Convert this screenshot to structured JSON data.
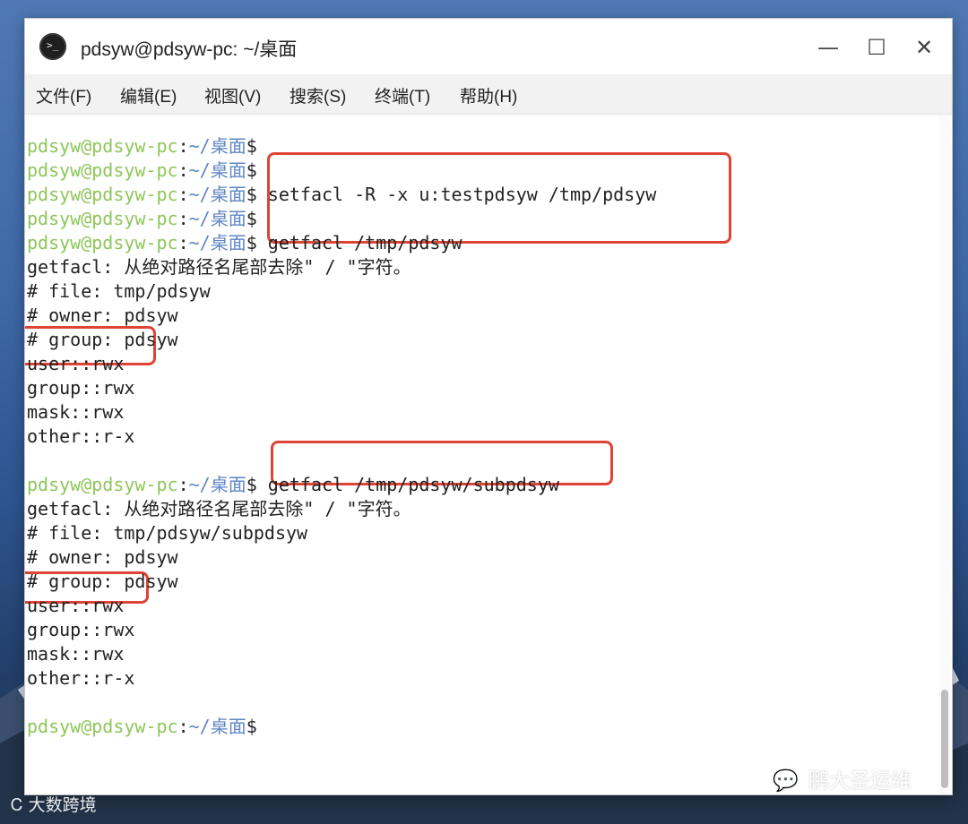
{
  "window": {
    "title": "pdsyw@pdsyw-pc: ~/桌面",
    "app_icon_glyph": ">_",
    "controls": {
      "minimize": "—",
      "maximize": "☐",
      "close": "✕"
    }
  },
  "menu": [
    "文件(F)",
    "编辑(E)",
    "视图(V)",
    "搜索(S)",
    "终端(T)",
    "帮助(H)"
  ],
  "prompt": {
    "user_host": "pdsyw@pdsyw-pc",
    "sep": ":",
    "path": "~/桌面",
    "symbol": "$"
  },
  "terminal": {
    "lines": [
      {
        "type": "prompt",
        "cmd": ""
      },
      {
        "type": "prompt",
        "cmd": ""
      },
      {
        "type": "prompt",
        "cmd": " setfacl -R -x u:testpdsyw /tmp/pdsyw"
      },
      {
        "type": "prompt",
        "cmd": ""
      },
      {
        "type": "prompt",
        "cmd": " getfacl /tmp/pdsyw"
      },
      {
        "type": "out",
        "text": "getfacl: 从绝对路径名尾部去除\" / \"字符。"
      },
      {
        "type": "out",
        "text": "# file: tmp/pdsyw"
      },
      {
        "type": "out",
        "text": "# owner: pdsyw"
      },
      {
        "type": "out",
        "text": "# group: pdsyw"
      },
      {
        "type": "out",
        "text": "user::rwx"
      },
      {
        "type": "out",
        "text": "group::rwx"
      },
      {
        "type": "out",
        "text": "mask::rwx"
      },
      {
        "type": "out",
        "text": "other::r-x"
      },
      {
        "type": "out",
        "text": ""
      },
      {
        "type": "prompt",
        "cmd": " getfacl /tmp/pdsyw/subpdsyw"
      },
      {
        "type": "out",
        "text": "getfacl: 从绝对路径名尾部去除\" / \"字符。"
      },
      {
        "type": "out",
        "text": "# file: tmp/pdsyw/subpdsyw"
      },
      {
        "type": "out",
        "text": "# owner: pdsyw"
      },
      {
        "type": "out",
        "text": "# group: pdsyw"
      },
      {
        "type": "out",
        "text": "user::rwx"
      },
      {
        "type": "out",
        "text": "group::rwx"
      },
      {
        "type": "out",
        "text": "mask::rwx"
      },
      {
        "type": "out",
        "text": "other::r-x"
      },
      {
        "type": "out",
        "text": ""
      },
      {
        "type": "prompt",
        "cmd": ""
      }
    ]
  },
  "watermarks": {
    "right": "鹏大圣运维",
    "left": "大数跨境"
  },
  "colors": {
    "user_host": "#8ec65a",
    "path": "#5f86c4",
    "highlight_box": "#dd4433"
  }
}
